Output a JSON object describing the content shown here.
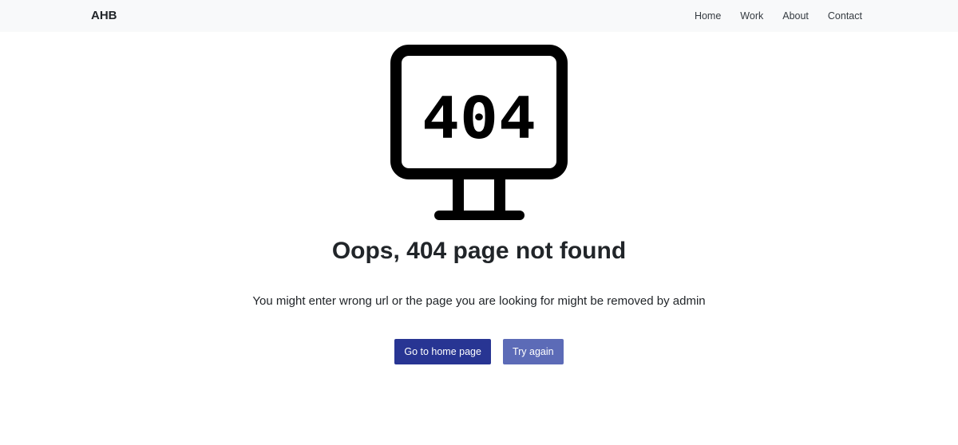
{
  "navbar": {
    "brand": "AHB",
    "links": [
      "Home",
      "Work",
      "About",
      "Contact"
    ]
  },
  "illustration": {
    "icon": "monitor-404-icon",
    "screen_text": "404"
  },
  "main": {
    "headline": "Oops, 404 page not found",
    "message": "You might enter wrong url or the page you are looking for might be removed by admin",
    "buttons": {
      "home_label": "Go to home page",
      "retry_label": "Try again"
    }
  },
  "colors": {
    "navbar_bg": "#f8f9fa",
    "primary_button": "#283593",
    "secondary_button": "#5c6bb7",
    "icon": "#000000"
  }
}
